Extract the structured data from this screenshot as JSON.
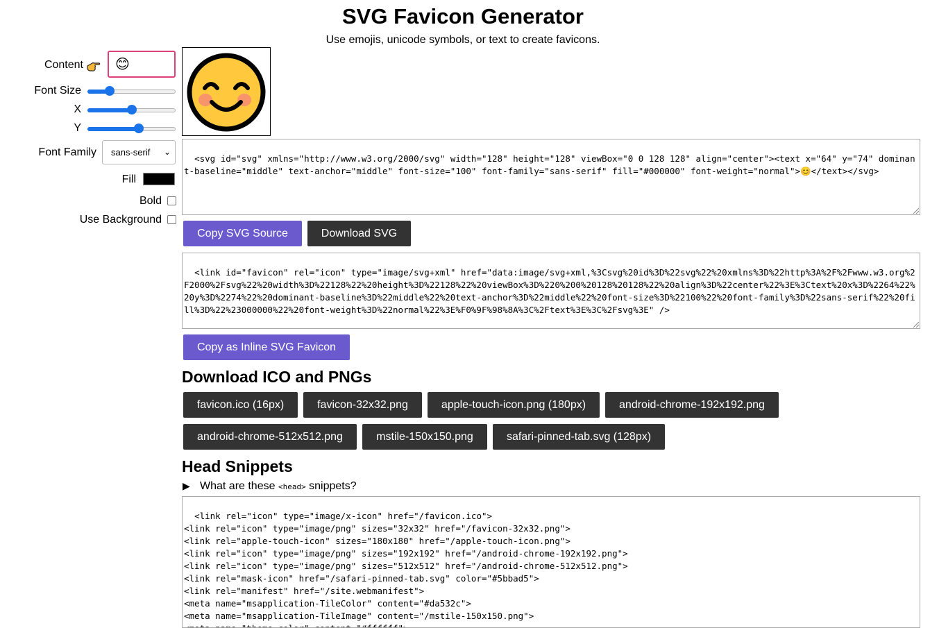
{
  "header": {
    "title": "SVG Favicon Generator",
    "subtitle": "Use emojis, unicode symbols, or text to create favicons."
  },
  "controls": {
    "content_label": "Content",
    "content_hint_icon": "pointing-hand-emoji",
    "content_value": "😊",
    "font_size_label": "Font Size",
    "font_size_level": 0.25,
    "x_label": "X",
    "x_level": 0.5,
    "y_label": "Y",
    "y_level": 0.58,
    "font_family_label": "Font Family",
    "font_family_value": "sans-serif",
    "fill_label": "Fill",
    "fill_color": "#000000",
    "bold_label": "Bold",
    "bold_checked": false,
    "use_background_label": "Use Background",
    "use_background_checked": false
  },
  "preview": {
    "emoji": "😊"
  },
  "svg_source": {
    "text": "<svg id=\"svg\" xmlns=\"http://www.w3.org/2000/svg\" width=\"128\" height=\"128\" viewBox=\"0 0 128 128\" align=\"center\"><text x=\"64\" y=\"74\" dominant-baseline=\"middle\" text-anchor=\"middle\" font-size=\"100\" font-family=\"sans-serif\" fill=\"#000000\" font-weight=\"normal\">😊</text></svg>",
    "copy_button": "Copy SVG Source",
    "download_button": "Download SVG"
  },
  "inline_favicon": {
    "text": "<link id=\"favicon\" rel=\"icon\" type=\"image/svg+xml\" href=\"data:image/svg+xml,%3Csvg%20id%3D%22svg%22%20xmlns%3D%22http%3A%2F%2Fwww.w3.org%2F2000%2Fsvg%22%20width%3D%22128%22%20height%3D%22128%22%20viewBox%3D%220%200%20128%20128%22%20align%3D%22center%22%3E%3Ctext%20x%3D%2264%22%20y%3D%2274%22%20dominant-baseline%3D%22middle%22%20text-anchor%3D%22middle%22%20font-size%3D%22100%22%20font-family%3D%22sans-serif%22%20fill%3D%22%23000000%22%20font-weight%3D%22normal%22%3E%F0%9F%98%8A%3C%2Ftext%3E%3C%2Fsvg%3E\" />",
    "copy_button": "Copy as Inline SVG Favicon"
  },
  "downloads": {
    "heading": "Download ICO and PNGs",
    "buttons": [
      "favicon.ico (16px)",
      "favicon-32x32.png",
      "apple-touch-icon.png (180px)",
      "android-chrome-192x192.png",
      "android-chrome-512x512.png",
      "mstile-150x150.png",
      "safari-pinned-tab.svg (128px)"
    ]
  },
  "head_snippets": {
    "heading": "Head Snippets",
    "details_marker": "▶",
    "details_prefix": "What are these",
    "details_code": "<head>",
    "details_suffix": "snippets?",
    "text": "<link rel=\"icon\" type=\"image/x-icon\" href=\"/favicon.ico\">\n<link rel=\"icon\" type=\"image/png\" sizes=\"32x32\" href=\"/favicon-32x32.png\">\n<link rel=\"apple-touch-icon\" sizes=\"180x180\" href=\"/apple-touch-icon.png\">\n<link rel=\"icon\" type=\"image/png\" sizes=\"192x192\" href=\"/android-chrome-192x192.png\">\n<link rel=\"icon\" type=\"image/png\" sizes=\"512x512\" href=\"/android-chrome-512x512.png\">\n<link rel=\"mask-icon\" href=\"/safari-pinned-tab.svg\" color=\"#5bbad5\">\n<link rel=\"manifest\" href=\"/site.webmanifest\">\n<meta name=\"msapplication-TileColor\" content=\"#da532c\">\n<meta name=\"msapplication-TileImage\" content=\"/mstile-150x150.png\">\n<meta name=\"theme-color\" content=\"#ffffff\">"
  },
  "colors": {
    "accent_purple": "#6a5acd",
    "dark_button": "#333333",
    "input_focus_border": "#e0407a",
    "slider_blue": "#1a73e8",
    "emoji_face": "#FFC83D",
    "emoji_blush": "#F7946B"
  }
}
